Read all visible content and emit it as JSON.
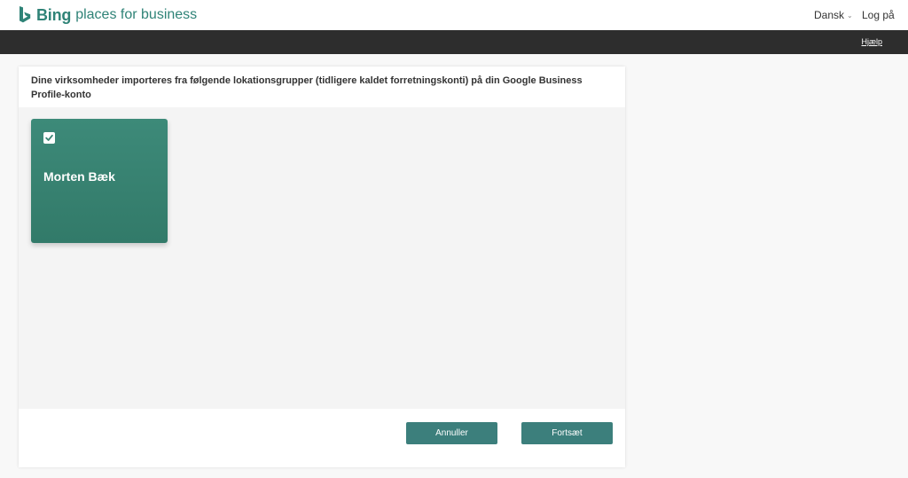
{
  "header": {
    "brand_bold": "Bing",
    "brand_rest": "places for business",
    "brand_color": "#2f8377",
    "language": "Dansk",
    "login": "Log på"
  },
  "navbar": {
    "help": "Hjælp"
  },
  "panel": {
    "title": "Dine virksomheder importeres fra følgende lokationsgrupper (tidligere kaldet forretningskonti) på din Google Business Profile-konto",
    "accounts": [
      {
        "name": "Morten Bæk",
        "checked": true,
        "color": "#3a8574"
      }
    ],
    "footer": {
      "cancel_label": "Annuller",
      "continue_label": "Fortsæt",
      "button_color": "#3c7f7c"
    }
  },
  "icons": {
    "logo": "bing-logo-icon",
    "caret": "chevron-down-icon",
    "check": "checkmark-icon"
  }
}
